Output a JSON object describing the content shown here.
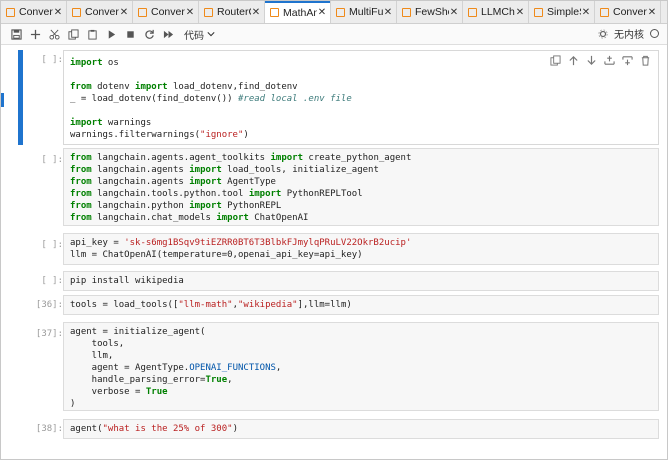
{
  "tabs": [
    {
      "label": "Convert",
      "active": false
    },
    {
      "label": "Convert",
      "active": false
    },
    {
      "label": "ConverS",
      "active": false
    },
    {
      "label": "RouterC",
      "active": false
    },
    {
      "label": "MathAn",
      "active": true
    },
    {
      "label": "MultiFu",
      "active": false
    },
    {
      "label": "FewSho",
      "active": false
    },
    {
      "label": "LLMCha",
      "active": false
    },
    {
      "label": "SimpleS",
      "active": false
    },
    {
      "label": "Convert",
      "active": false
    }
  ],
  "toolbar": {
    "kernel_dropdown": "代码",
    "kernel_status": "无内核",
    "icons": [
      "save-icon",
      "add-icon",
      "cut-icon",
      "copy-icon",
      "paste-icon",
      "run-icon",
      "stop-icon",
      "restart-icon",
      "fast-forward-icon",
      "chevron-down-icon"
    ]
  },
  "colors": {
    "accent": "#1f74ce",
    "tab_icon": "#ef8a1a",
    "keyword": "#008000",
    "string": "#ba2121",
    "comment": "#3d7b7b"
  },
  "cells": [
    {
      "prompt": "[ ]:",
      "lines": [
        [
          [
            "kw",
            "import"
          ],
          [
            "",
            " os"
          ]
        ],
        [],
        [
          [
            "kw",
            "from"
          ],
          [
            "",
            " dotenv "
          ],
          [
            "kw",
            "import"
          ],
          [
            "",
            " load_dotenv,find_dotenv"
          ]
        ],
        [
          [
            "",
            "_ = load_dotenv(find_dotenv()) "
          ],
          [
            "cm",
            "#read local .env file"
          ]
        ],
        [],
        [
          [
            "kw",
            "import"
          ],
          [
            "",
            " warnings"
          ]
        ],
        [
          [
            "",
            "warnings.filterwarnings("
          ],
          [
            "st",
            "\"ignore\""
          ],
          [
            "",
            ")"
          ]
        ]
      ]
    },
    {
      "prompt": "[ ]:",
      "lines": [
        [
          [
            "kw",
            "from"
          ],
          [
            "",
            " langchain.agents.agent_toolkits "
          ],
          [
            "kw",
            "import"
          ],
          [
            "",
            " create_python_agent"
          ]
        ],
        [
          [
            "kw",
            "from"
          ],
          [
            "",
            " langchain.agents "
          ],
          [
            "kw",
            "import"
          ],
          [
            "",
            " load_tools, initialize_agent"
          ]
        ],
        [
          [
            "kw",
            "from"
          ],
          [
            "",
            " langchain.agents "
          ],
          [
            "kw",
            "import"
          ],
          [
            "",
            " AgentType"
          ]
        ],
        [
          [
            "kw",
            "from"
          ],
          [
            "",
            " langchain.tools.python.tool "
          ],
          [
            "kw",
            "import"
          ],
          [
            "",
            " PythonREPLTool"
          ]
        ],
        [
          [
            "kw",
            "from"
          ],
          [
            "",
            " langchain.python "
          ],
          [
            "kw",
            "import"
          ],
          [
            "",
            " PythonREPL"
          ]
        ],
        [
          [
            "kw",
            "from"
          ],
          [
            "",
            " langchain.chat_models "
          ],
          [
            "kw",
            "import"
          ],
          [
            "",
            " ChatOpenAI"
          ]
        ]
      ]
    },
    {
      "prompt": "[ ]:",
      "lines": [
        [
          [
            "",
            "api_key = "
          ],
          [
            "st",
            "'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'"
          ]
        ],
        [
          [
            "",
            "llm = ChatOpenAI(temperature=0,openai_api_key=api_key)"
          ]
        ]
      ]
    },
    {
      "prompt": "[ ]:",
      "lines": [
        [
          [
            "",
            "pip install wikipedia"
          ]
        ]
      ]
    },
    {
      "prompt": "[36]:",
      "lines": [
        [
          [
            "",
            "tools = load_tools(["
          ],
          [
            "st",
            "\"llm-math\""
          ],
          [
            "",
            ","
          ],
          [
            "st",
            "\"wikipedia\""
          ],
          [
            "",
            "],llm=llm)"
          ]
        ]
      ]
    },
    {
      "prompt": "[37]:",
      "lines": [
        [
          [
            "",
            "agent = initialize_agent("
          ]
        ],
        [
          [
            "",
            "    tools,"
          ]
        ],
        [
          [
            "",
            "    llm,"
          ]
        ],
        [
          [
            "",
            "    agent = AgentType."
          ],
          [
            "attr",
            "OPENAI_FUNCTIONS"
          ],
          [
            "",
            ","
          ]
        ],
        [
          [
            "",
            "    handle_parsing_error="
          ],
          [
            "kw",
            "True"
          ],
          [
            "",
            ","
          ]
        ],
        [
          [
            "",
            "    verbose = "
          ],
          [
            "kw",
            "True"
          ]
        ],
        [
          [
            "",
            ")"
          ]
        ]
      ]
    },
    {
      "prompt": "[38]:",
      "lines": [
        [
          [
            "",
            "agent("
          ],
          [
            "st",
            "\"what is the 25% of 300\""
          ],
          [
            "",
            ")"
          ]
        ]
      ]
    }
  ]
}
